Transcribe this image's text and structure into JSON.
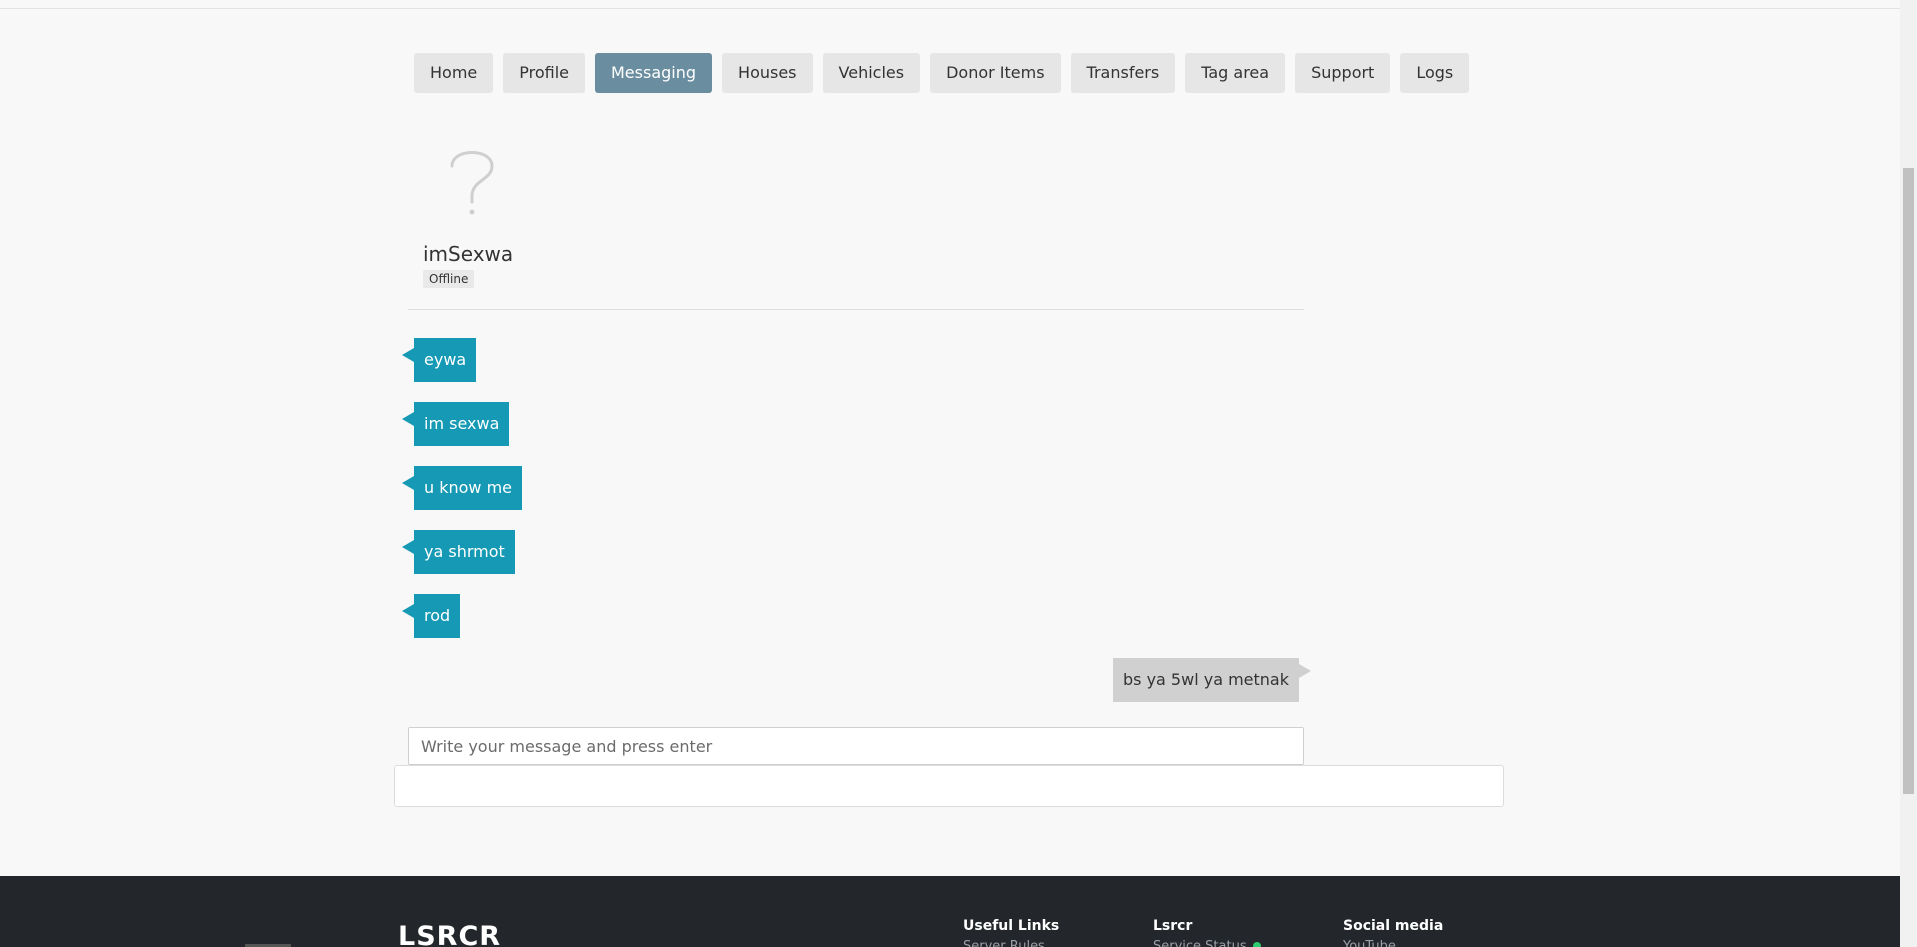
{
  "nav": {
    "tabs": [
      {
        "label": "Home",
        "active": false
      },
      {
        "label": "Profile",
        "active": false
      },
      {
        "label": "Messaging",
        "active": true
      },
      {
        "label": "Houses",
        "active": false
      },
      {
        "label": "Vehicles",
        "active": false
      },
      {
        "label": "Donor Items",
        "active": false
      },
      {
        "label": "Transfers",
        "active": false
      },
      {
        "label": "Tag area",
        "active": false
      },
      {
        "label": "Support",
        "active": false
      },
      {
        "label": "Logs",
        "active": false
      }
    ]
  },
  "contact": {
    "avatar_icon": "question-mark-icon",
    "name": "imSexwa",
    "status": "Offline"
  },
  "messages": [
    {
      "direction": "in",
      "text": "eywa"
    },
    {
      "direction": "in",
      "text": "im sexwa"
    },
    {
      "direction": "in",
      "text": "u know me"
    },
    {
      "direction": "in",
      "text": "ya shrmot"
    },
    {
      "direction": "in",
      "text": "rod"
    },
    {
      "direction": "out",
      "text": "bs ya 5wl ya metnak"
    }
  ],
  "composer": {
    "placeholder": "Write your message and press enter",
    "value": ""
  },
  "footer": {
    "brand": "LSRCR",
    "columns": [
      {
        "heading": "Useful Links",
        "first_item": "Server Rules"
      },
      {
        "heading": "Lsrcr",
        "first_item": "Service Status"
      },
      {
        "heading": "Social media",
        "first_item": "YouTube"
      }
    ]
  },
  "colors": {
    "active_tab": "#6a8ea0",
    "incoming_bubble": "#1599b4",
    "outgoing_bubble": "#d0d0d0",
    "footer_bg": "#23272b"
  }
}
